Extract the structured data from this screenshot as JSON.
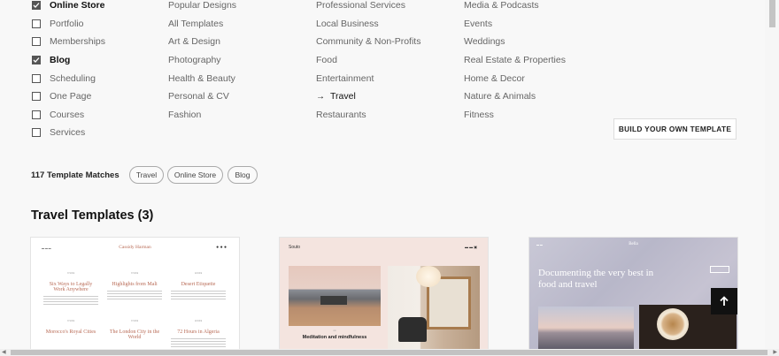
{
  "filters": {
    "types": [
      {
        "label": "Online Store",
        "checked": true
      },
      {
        "label": "Portfolio",
        "checked": false
      },
      {
        "label": "Memberships",
        "checked": false
      },
      {
        "label": "Blog",
        "checked": true
      },
      {
        "label": "Scheduling",
        "checked": false
      },
      {
        "label": "One Page",
        "checked": false
      },
      {
        "label": "Courses",
        "checked": false
      },
      {
        "label": "Services",
        "checked": false
      }
    ],
    "topics_col1": [
      "Popular Designs",
      "All Templates",
      "Art & Design",
      "Photography",
      "Health & Beauty",
      "Personal & CV",
      "Fashion"
    ],
    "topics_col2": [
      "Professional Services",
      "Local Business",
      "Community & Non-Profits",
      "Food",
      "Entertainment",
      "Travel",
      "Restaurants"
    ],
    "topics_col3": [
      "Media & Podcasts",
      "Events",
      "Weddings",
      "Real Estate & Properties",
      "Home & Decor",
      "Nature & Animals",
      "Fitness"
    ],
    "selected_topic": "Travel",
    "selected_arrow": "→"
  },
  "build_button": "BUILD YOUR OWN TEMPLATE",
  "matches": {
    "count_label": "117 Template Matches",
    "chips": [
      "Travel",
      "Online Store",
      "Blog"
    ]
  },
  "section_heading": "Travel Templates (3)",
  "cards": {
    "card1": {
      "brand": "Cassidy Harman",
      "posts": [
        {
          "date": "7/1/19",
          "title": "Six Ways to Legally Work Anywhere"
        },
        {
          "date": "7/1/19",
          "title": "Highlights from Mali"
        },
        {
          "date": "4/1/19",
          "title": "Desert Etiquette"
        },
        {
          "date": "7/1/19",
          "title": "Morocco's Royal Cities"
        },
        {
          "date": "7/1/19",
          "title": "The London City in the World"
        },
        {
          "date": "4/1/19",
          "title": "72 Hours in Algeria"
        }
      ]
    },
    "card2": {
      "brand": "Souto",
      "caption": "Meditation and mindfulness"
    },
    "card3": {
      "brand": "Bella",
      "headline": "Documenting the very best in food and travel"
    }
  },
  "colors": {
    "accent": "#111111",
    "background": "#f8f8f8"
  }
}
